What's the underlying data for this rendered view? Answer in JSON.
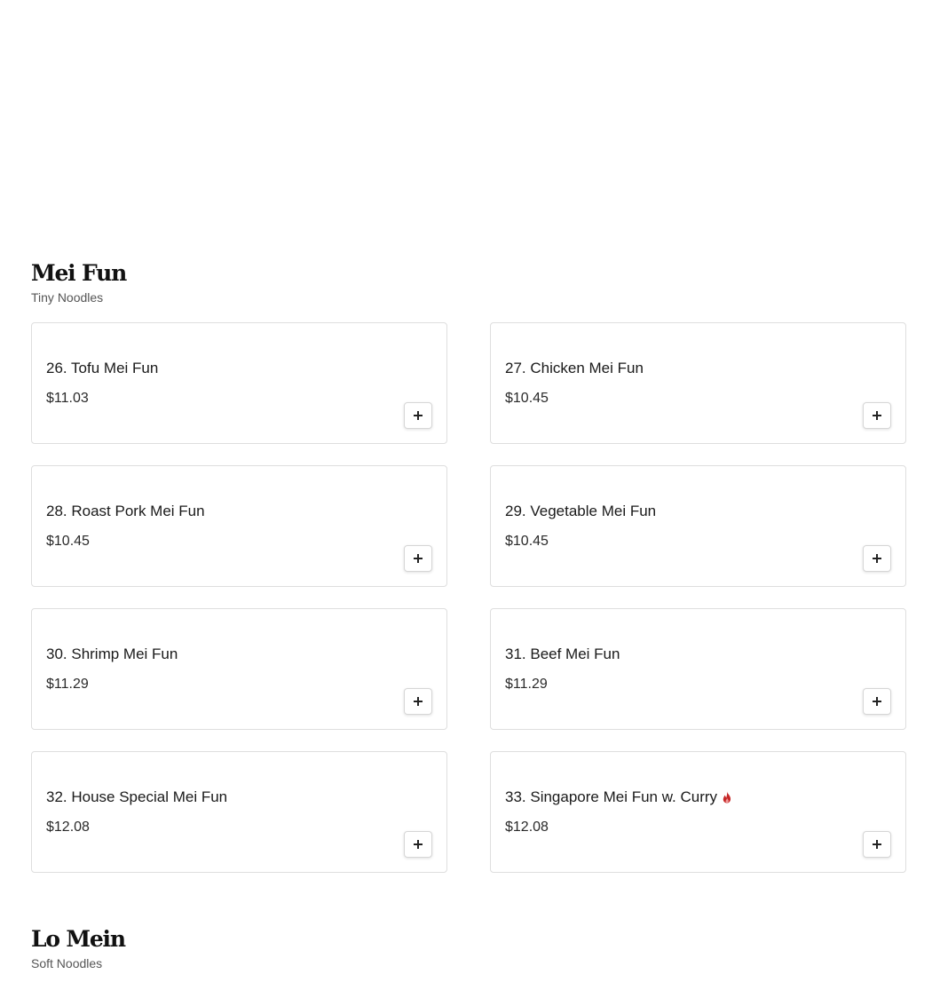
{
  "sections": [
    {
      "title": "Mei Fun",
      "subtitle": "Tiny Noodles",
      "items": [
        {
          "name": "26. Tofu Mei Fun",
          "price": "$11.03",
          "spicy": false
        },
        {
          "name": "27. Chicken Mei Fun",
          "price": "$10.45",
          "spicy": false
        },
        {
          "name": "28. Roast Pork Mei Fun",
          "price": "$10.45",
          "spicy": false
        },
        {
          "name": "29. Vegetable Mei Fun",
          "price": "$10.45",
          "spicy": false
        },
        {
          "name": "30. Shrimp Mei Fun",
          "price": "$11.29",
          "spicy": false
        },
        {
          "name": "31. Beef Mei Fun",
          "price": "$11.29",
          "spicy": false
        },
        {
          "name": "32. House Special Mei Fun",
          "price": "$12.08",
          "spicy": false
        },
        {
          "name": "33. Singapore Mei Fun w. Curry",
          "price": "$12.08",
          "spicy": true
        }
      ]
    },
    {
      "title": "Lo Mein",
      "subtitle": "Soft Noodles"
    }
  ],
  "icons": {
    "add": "plus-icon",
    "spicy": "flame-icon"
  },
  "colors": {
    "spicy": "#c62828",
    "card_border": "#dedede"
  }
}
